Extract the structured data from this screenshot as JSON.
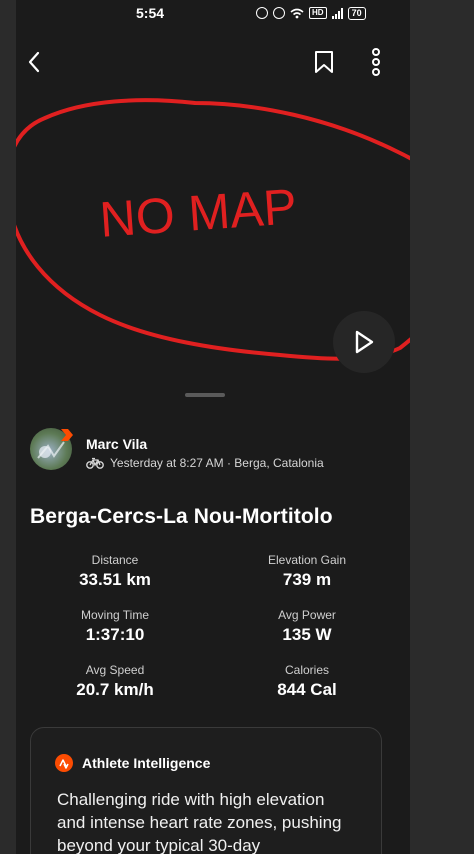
{
  "status_bar": {
    "time": "5:54",
    "hd_label": "HD",
    "battery": "70"
  },
  "map_overlay": {
    "annotation_text": "NO MAP"
  },
  "athlete": {
    "name": "Marc Vila",
    "timestamp_location": "Yesterday at 8:27 AM · Berga, Catalonia",
    "activity_icon": "bike-icon"
  },
  "activity": {
    "title": "Berga-Cercs-La Nou-Mortitolo"
  },
  "stats": [
    {
      "label": "Distance",
      "value": "33.51 km"
    },
    {
      "label": "Elevation Gain",
      "value": "739 m"
    },
    {
      "label": "Moving Time",
      "value": "1:37:10"
    },
    {
      "label": "Avg Power",
      "value": "135 W"
    },
    {
      "label": "Avg Speed",
      "value": "20.7 km/h"
    },
    {
      "label": "Calories",
      "value": "844 Cal"
    }
  ],
  "ai_card": {
    "title": "Athlete Intelligence",
    "text": "Challenging ride with high elevation and intense heart rate zones, pushing beyond your typical 30-day"
  },
  "colors": {
    "accent": "#fc4c02",
    "annotation": "#e02020",
    "background": "#1b1b1b"
  }
}
